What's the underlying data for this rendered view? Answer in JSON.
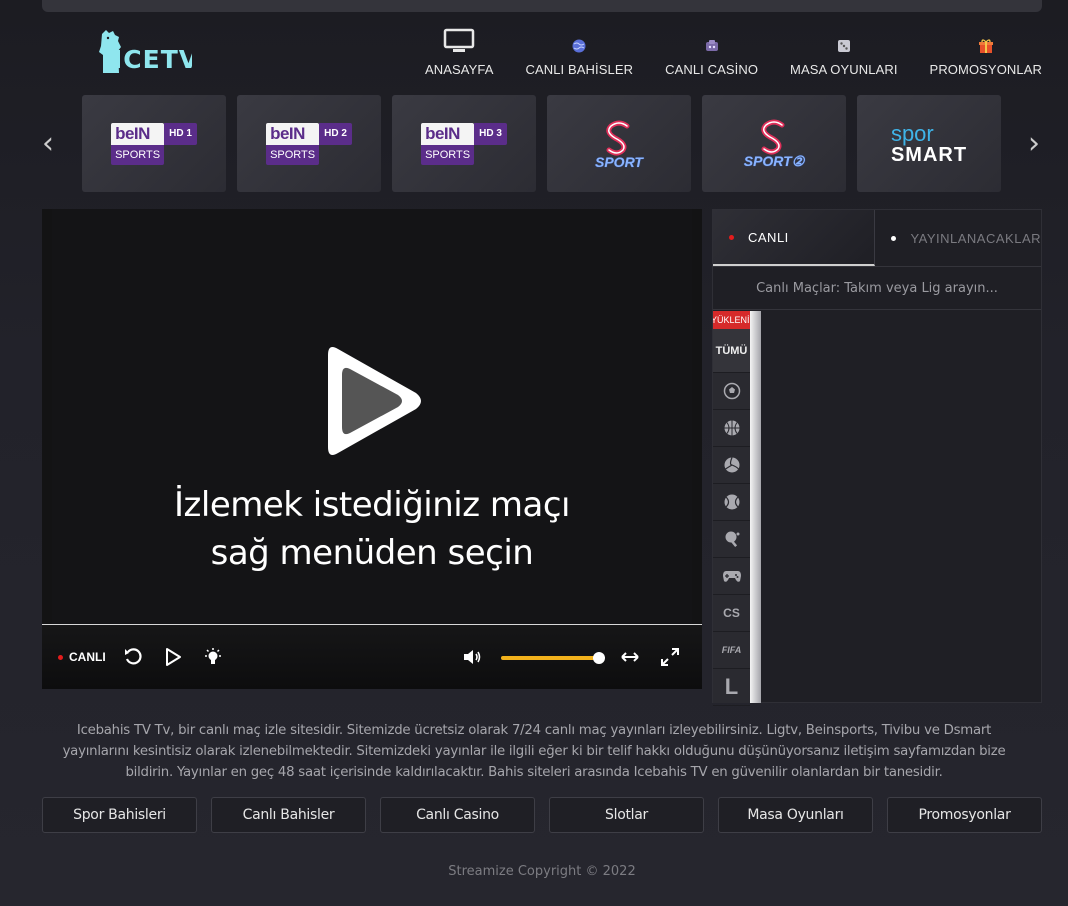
{
  "brand": {
    "logo_text": "ICETV"
  },
  "nav": [
    {
      "label": "ANASAYFA",
      "icon": "monitor-icon"
    },
    {
      "label": "CANLI BAHİSLER",
      "icon": "globe-icon"
    },
    {
      "label": "CANLI CASİNO",
      "icon": "casino-chip-icon"
    },
    {
      "label": "MASA OYUNLARI",
      "icon": "dice-icon"
    },
    {
      "label": "PROMOSYONLAR",
      "icon": "gift-icon"
    }
  ],
  "channels": [
    {
      "type": "bein",
      "word": "beIN",
      "hd": "HD 1",
      "sub": "SPORTS"
    },
    {
      "type": "bein",
      "word": "beIN",
      "hd": "HD 2",
      "sub": "SPORTS"
    },
    {
      "type": "bein",
      "word": "beIN",
      "hd": "HD 3",
      "sub": "SPORTS"
    },
    {
      "type": "ssport",
      "text": "SPORT"
    },
    {
      "type": "ssport",
      "text": "SPORT②"
    },
    {
      "type": "spor",
      "line1": "spor",
      "line2": "SMART"
    }
  ],
  "player": {
    "message_line1": "İzlemek istediğiniz maçı",
    "message_line2": "sağ menüden seçin",
    "live_label": "CANLI",
    "volume": 1.0
  },
  "side": {
    "tab_live": "CANLI",
    "tab_upcoming": "YAYINLANACAKLAR",
    "search_placeholder": "Canlı Maçlar: Takım veya Lig arayın...",
    "loading": "YÜKLENİYOR",
    "all": "TÜMÜ",
    "sports": [
      {
        "icon": "football-icon"
      },
      {
        "icon": "basketball-icon"
      },
      {
        "icon": "volleyball-icon"
      },
      {
        "icon": "tennis-icon"
      },
      {
        "icon": "table-tennis-icon"
      },
      {
        "icon": "gamepad-icon"
      },
      {
        "label": "CS",
        "icon": "cs-icon"
      },
      {
        "label": "FIFA",
        "icon": "fifa-icon"
      },
      {
        "label": "L",
        "icon": "lol-icon"
      }
    ]
  },
  "footer": {
    "about": "Icebahis TV Tv, bir canlı maç izle sitesidir. Sitemizde ücretsiz olarak 7/24 canlı maç yayınları izleyebilirsiniz. Ligtv, Beinsports, Tivibu ve Dsmart yayınlarını kesintisiz olarak izlenebilmektedir. Sitemizdeki yayınlar ile ilgili eğer ki bir telif hakkı olduğunu düşünüyorsanız iletişim sayfamızdan bize bildirin. Yayınlar en geç 48 saat içerisinde kaldırılacaktır. Bahis siteleri arasında Icebahis TV en güvenilir olanlardan bir tanesidir.",
    "buttons": [
      "Spor Bahisleri",
      "Canlı Bahisler",
      "Canlı Casino",
      "Slotlar",
      "Masa Oyunları",
      "Promosyonlar"
    ],
    "copyright": "Streamize Copyright © 2022"
  },
  "colors": {
    "accent": "#f2b21c",
    "live": "#e41c1c",
    "bein_purple": "#5b2d8a",
    "logo": "#8fe6ee"
  }
}
